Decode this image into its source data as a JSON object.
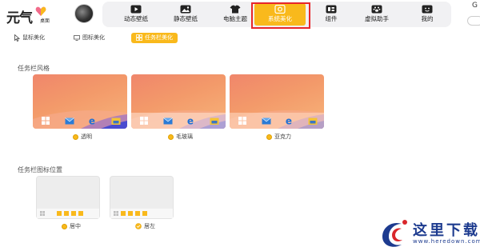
{
  "app": {
    "logo_text": "元气",
    "logo_sub": "桌面",
    "brand_color": "#f9b91c",
    "highlight_color": "#e8262b"
  },
  "nav": {
    "items": [
      {
        "label": "动态壁纸",
        "icon": "play-icon"
      },
      {
        "label": "静态壁纸",
        "icon": "image-icon"
      },
      {
        "label": "电脑主题",
        "icon": "shirt-icon"
      },
      {
        "label": "系统美化",
        "icon": "palette-icon",
        "active": true
      },
      {
        "label": "组件",
        "icon": "widget-icon"
      },
      {
        "label": "虚拟助手",
        "icon": "paw-icon"
      },
      {
        "label": "我的",
        "icon": "user-icon"
      }
    ]
  },
  "header_right": {
    "glyph": "G"
  },
  "subtabs": [
    {
      "label": "鼠标美化",
      "icon": "cursor-icon"
    },
    {
      "label": "图标美化",
      "icon": "monitor-icon"
    },
    {
      "label": "任务栏美化",
      "icon": "taskbar-icon",
      "active": true
    }
  ],
  "taskbar_style": {
    "title": "任务栏风格",
    "options": [
      {
        "label": "透明"
      },
      {
        "label": "毛玻璃"
      },
      {
        "label": "亚克力"
      }
    ]
  },
  "icon_position": {
    "title": "任务栏图标位置",
    "options": [
      {
        "label": "居中"
      },
      {
        "label": "居左",
        "selected": true
      }
    ]
  },
  "watermark": {
    "text": "这里下载",
    "url": "www.heredown.com"
  }
}
